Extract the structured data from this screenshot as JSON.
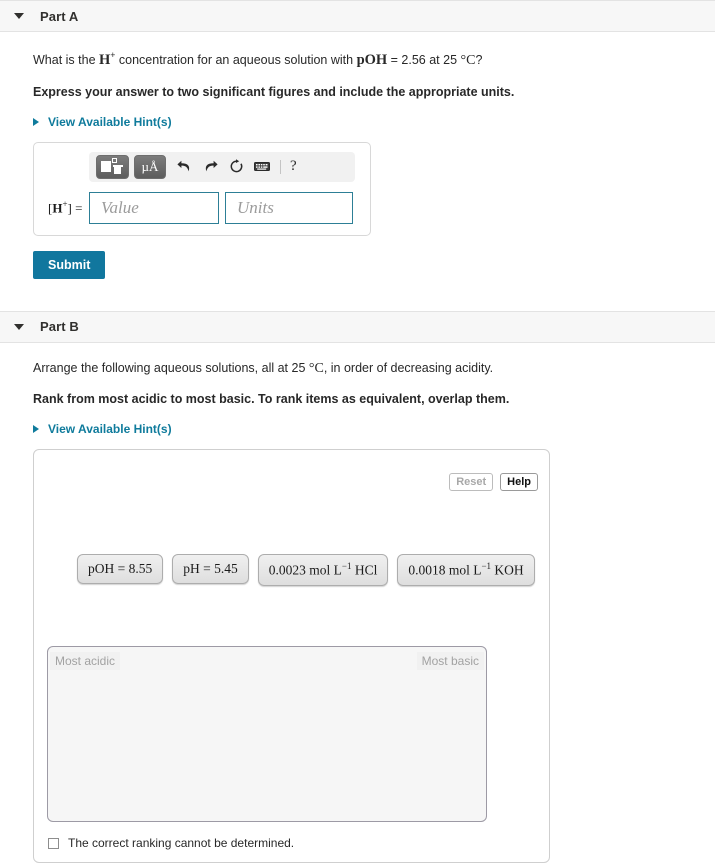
{
  "parts": [
    {
      "id": "part-a",
      "title": "Part A",
      "collapse_icon": "caret-down-icon",
      "question_prefix": "What is the ",
      "question_symbol": "H",
      "question_symbol_sup": "+",
      "question_mid": " concentration for an aqueous solution with ",
      "question_poh": "pOH",
      "question_value": " = 2.56 at 25 ",
      "question_degree": "°C",
      "question_suffix": "?",
      "instruction": "Express your answer to two significant figures and include the appropriate units.",
      "hint_label": "View Available Hint(s)",
      "hint_icon": "caret-right-icon",
      "toolbar": {
        "template_button": "template-icon",
        "units_button": "μA",
        "units_button_ring": "˚",
        "undo": "undo-icon",
        "redo": "redo-icon",
        "reset": "reset-icon",
        "keyboard": "keyboard-icon",
        "help": "?"
      },
      "answer": {
        "label_open": "[",
        "label_symbol": "H",
        "label_sup": "+",
        "label_close": "] =",
        "value_placeholder": "Value",
        "value_text": "",
        "units_placeholder": "Units",
        "units_text": ""
      },
      "submit_label": "Submit"
    },
    {
      "id": "part-b",
      "title": "Part B",
      "collapse_icon": "caret-down-icon",
      "question_prefix": "Arrange the following aqueous solutions, all at 25 ",
      "question_degree": "°C",
      "question_suffix": ", in order of decreasing acidity.",
      "instruction": "Rank from most acidic to most basic. To rank items as equivalent, overlap them.",
      "hint_label": "View Available Hint(s)",
      "hint_icon": "caret-right-icon",
      "ranking": {
        "reset_label": "Reset",
        "reset_disabled": true,
        "help_label": "Help",
        "tiles": [
          {
            "text": "pOH = 8.55",
            "has_sup": false
          },
          {
            "text": "pH = 5.45",
            "has_sup": false
          },
          {
            "pre": "0.0023 mol L",
            "sup": "−1",
            "post": " HCl",
            "has_sup": true
          },
          {
            "pre": "0.0018 mol L",
            "sup": "−1",
            "post": " KOH",
            "has_sup": true
          }
        ],
        "dropzone_left_label": "Most acidic",
        "dropzone_right_label": "Most basic",
        "cannot_determine_label": "The correct ranking cannot be determined.",
        "cannot_determine_checked": false
      }
    }
  ],
  "colors": {
    "accent_teal": "#0f7b9c",
    "submit_blue": "#11779e",
    "field_border": "#2d7f96",
    "header_bg": "#f7f7f7",
    "placeholder_gray": "#9b9b9b"
  }
}
